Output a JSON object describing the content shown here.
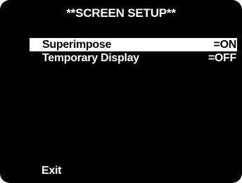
{
  "menu_title": "**SCREEN SETUP**",
  "items": [
    {
      "label": "Superimpose",
      "value": "=ON",
      "selected": true
    },
    {
      "label": "Temporary Display",
      "value": "=OFF",
      "selected": false
    }
  ],
  "exit_label": "Exit",
  "colors": {
    "background": "#000000",
    "text": "#ffffff",
    "highlight": "#ffffff",
    "highlight_text": "#000000"
  },
  "icons": {
    "cursor": "triangle-right-icon"
  }
}
